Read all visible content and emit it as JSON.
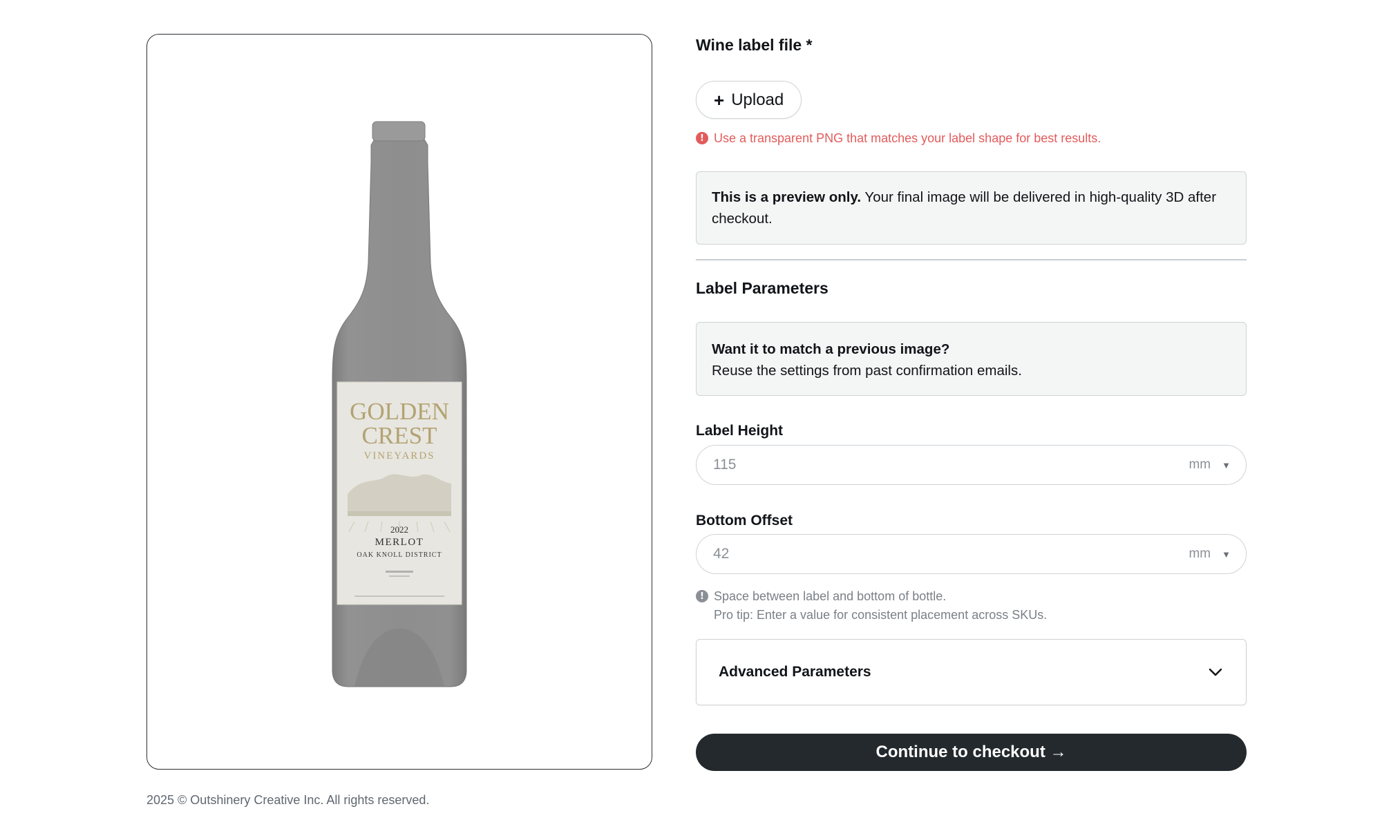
{
  "preview": {
    "label_brand_line1": "GOLDEN",
    "label_brand_line2": "CREST",
    "label_brand_line3": "VINEYARDS",
    "label_year": "2022",
    "label_varietal": "MERLOT",
    "label_region": "OAK KNOLL DISTRICT",
    "bottle_color": "#8e8e8e",
    "label_color": "#e7e6e0",
    "label_text_color": "#b3a272"
  },
  "form": {
    "file_label": "Wine label file *",
    "upload_label": "Upload",
    "upload_icon": "plus-icon",
    "file_hint": "Use a transparent PNG that matches your label shape for best results.",
    "preview_notice_bold": "This is a preview only.",
    "preview_notice_text": " Your final image will be delivered in high-quality 3D after checkout.",
    "params_title": "Label Parameters",
    "match_title": "Want it to match a previous image?",
    "match_text": "Reuse the settings from past confirmation emails.",
    "height_label": "Label Height",
    "height_placeholder": "115",
    "height_unit": "mm",
    "offset_label": "Bottom Offset",
    "offset_placeholder": "42",
    "offset_unit": "mm",
    "offset_help_1": "Space between label and bottom of bottle.",
    "offset_help_2": "Pro tip: Enter a value for consistent placement across SKUs.",
    "advanced_label": "Advanced Parameters",
    "checkout_label": "Continue to checkout →"
  },
  "footer": {
    "copyright": "2025 © Outshinery Creative Inc. All rights reserved."
  },
  "colors": {
    "accent_dark": "#23292d",
    "error": "#e35b5b",
    "info_bg": "#f4f6f5"
  }
}
